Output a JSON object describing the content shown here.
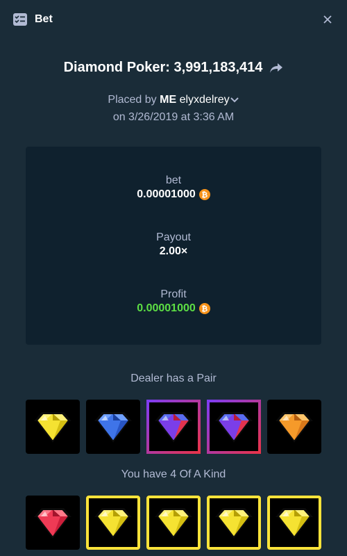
{
  "header": {
    "title": "Bet",
    "icon": "list-check-icon",
    "close_icon": "close-icon"
  },
  "game": {
    "title": "Diamond Poker: 3,991,183,414",
    "share_icon": "share-arrow-icon"
  },
  "placed": {
    "prefix": "Placed by",
    "me": "ME",
    "user": "elyxdelrey",
    "date_line": "on 3/26/2019 at 3:36 AM"
  },
  "stats": {
    "bet_label": "bet",
    "bet_value": "0.00001000",
    "payout_label": "Payout",
    "payout_value": "2.00×",
    "profit_label": "Profit",
    "profit_value": "0.00001000",
    "currency_icon": "bitcoin-icon",
    "profit_color": "#5ddf44"
  },
  "dealer": {
    "label": "Dealer has a Pair",
    "gems": [
      "yellow",
      "blue",
      "purple",
      "purple",
      "orange"
    ],
    "highlight": [
      false,
      false,
      true,
      true,
      false
    ]
  },
  "player": {
    "label": "You have 4 Of A Kind",
    "gems": [
      "red",
      "yellow",
      "yellow",
      "yellow",
      "yellow"
    ],
    "highlight": [
      false,
      true,
      true,
      true,
      true
    ]
  },
  "colors": {
    "background": "#1a2c38",
    "panel": "#0f212e",
    "kind_border": "#fde33a",
    "pair_border_start": "#7e3cf2",
    "pair_border_end": "#e8334a"
  }
}
